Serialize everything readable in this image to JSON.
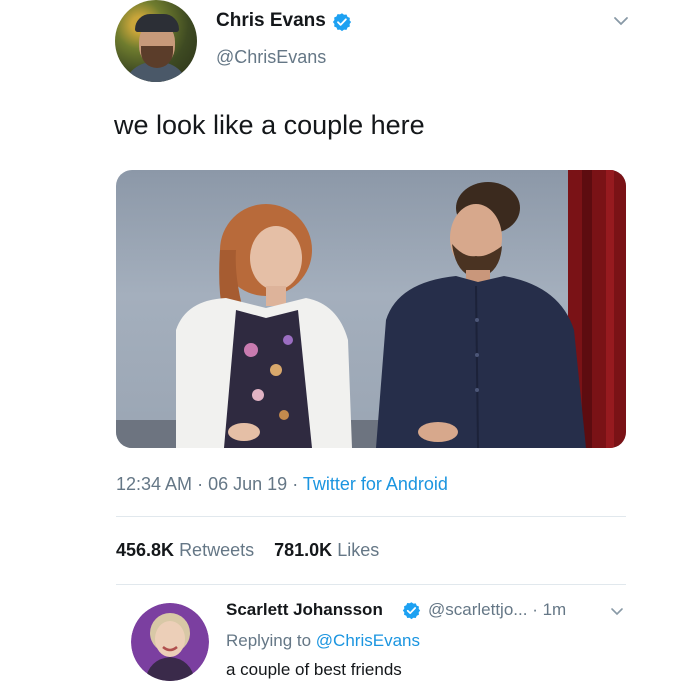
{
  "tweet": {
    "author_name": "Chris Evans",
    "author_handle": "@ChrisEvans",
    "text": "we look like a couple here",
    "time": "12:34 AM",
    "date": "06 Jun 19",
    "source": "Twitter for Android",
    "separator": "·",
    "retweet_count": "456.8K",
    "retweet_label": "Retweets",
    "like_count": "781.0K",
    "like_label": "Likes",
    "icons": [
      "verified-icon",
      "chevron-down-icon"
    ]
  },
  "reply": {
    "author_name": "Scarlett Johansson",
    "author_handle": "@scarlettjo...",
    "time_ago": "· 1m",
    "replying_prefix": "Replying to",
    "replying_to": "@ChrisEvans",
    "text": "a couple of best friends"
  },
  "colors": {
    "verified": "#1da1f2",
    "link": "#1b95e0",
    "secondary_text": "#657786",
    "primary_text": "#14171a",
    "divider": "#e1e8ed"
  }
}
